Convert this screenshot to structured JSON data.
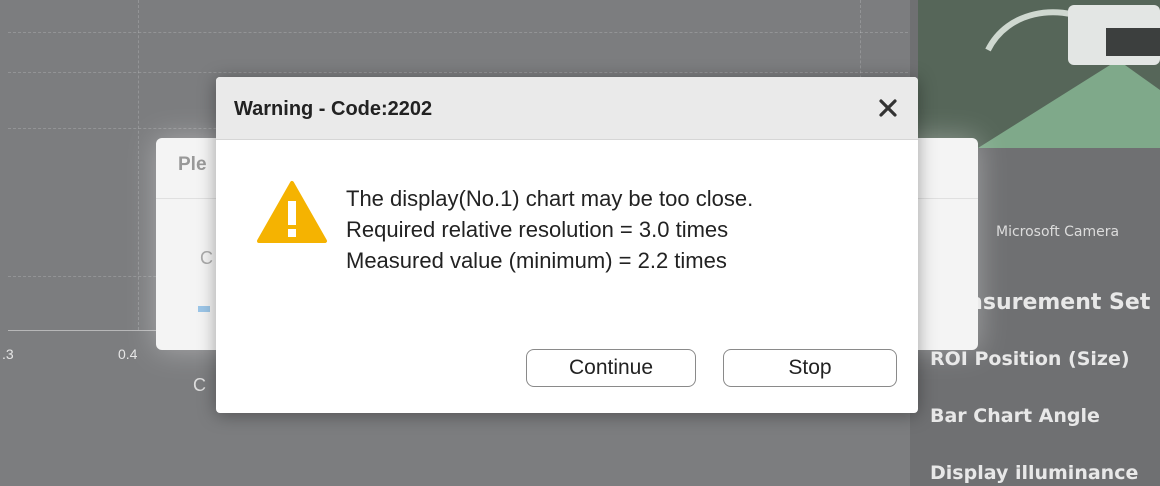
{
  "background": {
    "axis_ticks": [
      ".3",
      "0.4"
    ],
    "under_dialog": {
      "title_fragment": "Ple",
      "fragment_1": "C",
      "fragment_2": "C"
    },
    "right_panel": {
      "camera_label": "Microsoft Camera",
      "heading": "asurement Set",
      "items": [
        "ROI Position (Size)",
        "Bar Chart Angle",
        "Display illuminance"
      ]
    }
  },
  "dialog": {
    "title": "Warning - Code:2202",
    "close_icon": "close-icon",
    "warning_icon": "warning-triangle-icon",
    "message_lines": [
      "The display(No.1) chart may be too close.",
      "Required relative resolution = 3.0 times",
      "Measured value (minimum) = 2.2 times"
    ],
    "buttons": {
      "continue": "Continue",
      "stop": "Stop"
    }
  },
  "colors": {
    "warning": "#f5b301",
    "dialog_header": "#eaeaea"
  }
}
